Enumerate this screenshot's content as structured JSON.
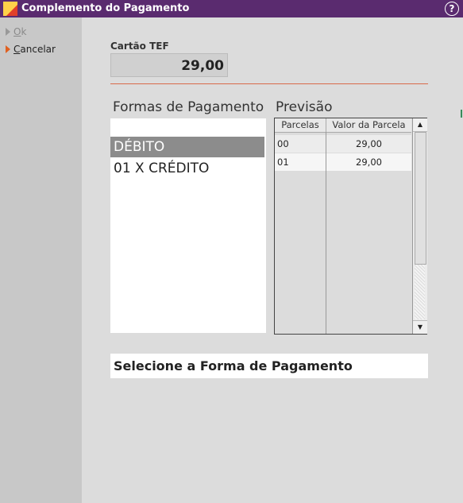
{
  "window": {
    "title": "Complemento do Pagamento",
    "help_icon": "?"
  },
  "sidebar": {
    "ok_first": "O",
    "ok_rest": "k",
    "cancel_first": "C",
    "cancel_rest": "ancelar"
  },
  "tef": {
    "label": "Cartão TEF",
    "value": "29,00"
  },
  "formas": {
    "label": "Formas de Pagamento",
    "items": [
      "DÉBITO",
      "01 X CRÉDITO"
    ],
    "selected": 0
  },
  "previsao": {
    "label": "Previsão",
    "columns": [
      "Parcelas",
      "Valor da Parcela"
    ],
    "rows": [
      {
        "parcela": "00",
        "valor": "29,00"
      },
      {
        "parcela": "01",
        "valor": "29,00"
      }
    ]
  },
  "status": {
    "text": "Selecione a Forma de Pagamento"
  },
  "colors": {
    "title_bar": "#5a2b6f",
    "separator": "#d96a4a",
    "cancel_arrow": "#e06020",
    "selection": "#8c8c8c"
  }
}
